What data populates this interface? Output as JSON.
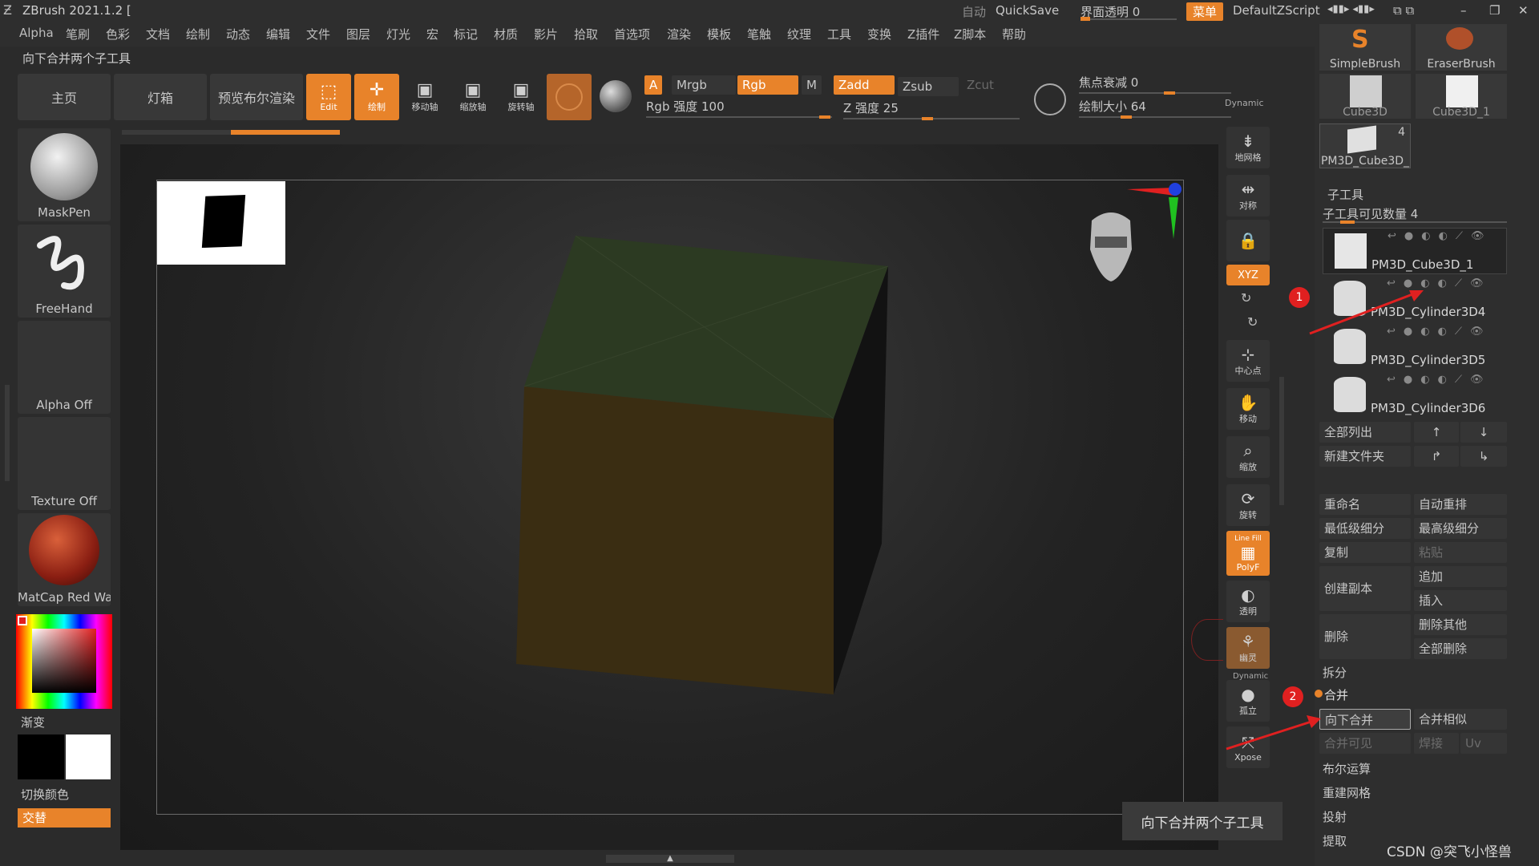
{
  "app": {
    "title": "ZBrush 2021.1.2 [",
    "auto_label": "自动",
    "quickscript": "QuickSave",
    "ui_transparency": "界面透明 0",
    "menu_pill": "菜单",
    "script_name": "DefaultZScript"
  },
  "menu": [
    "Alpha",
    "笔刷",
    "色彩",
    "文档",
    "绘制",
    "动态",
    "编辑",
    "文件",
    "图层",
    "灯光",
    "宏",
    "标记",
    "材质",
    "影片",
    "拾取",
    "首选项",
    "渲染",
    "模板",
    "笔触",
    "纹理",
    "工具",
    "变换",
    "Z插件",
    "Z脚本",
    "帮助"
  ],
  "status_text": "向下合并两个子工具",
  "toolbar": {
    "home": "主页",
    "lightbox": "灯箱",
    "bpr": "预览布尔渲染",
    "edit": "Edit",
    "draw": "绘制",
    "move": "移动轴",
    "scale": "缩放轴",
    "rotate": "旋转轴",
    "a": "A",
    "mrgb": "Mrgb",
    "rgb": "Rgb",
    "m": "M",
    "zadd": "Zadd",
    "zsub": "Zsub",
    "zcut": "Zcut",
    "rgb_intensity": "Rgb 强度 100",
    "z_intensity": "Z 强度 25",
    "focal_shift": "焦点衰减 0",
    "draw_size": "绘制大小 64",
    "dynamic": "Dynamic",
    "rgb_intensity_value": 100,
    "z_intensity_value": 25,
    "focal_shift_value": 0,
    "draw_size_value": 64
  },
  "left_panel": {
    "brush": "MaskPen",
    "stroke": "FreeHand",
    "alpha": "Alpha Off",
    "texture": "Texture Off",
    "material": "MatCap Red Wax",
    "gradient": "渐变",
    "switch_color": "切换颜色",
    "alternate": "交替"
  },
  "right_strip": {
    "floor": "地网格",
    "sym": "对称",
    "xyz": "XYZ",
    "center": "中心点",
    "move": "移动",
    "zoom": "缩放",
    "rotate": "旋转",
    "linefill_top": "Line Fill",
    "linefill": "PolyF",
    "transp": "透明",
    "ghost": "幽灵",
    "dynamic": "Dynamic",
    "solo": "孤立",
    "xpose": "Xpose"
  },
  "tool_palette": {
    "tools": [
      "SimpleBrush",
      "EraserBrush",
      "Cube3D",
      "Cube3D_1"
    ],
    "current_tool": "PM3D_Cube3D_",
    "current_count": "4"
  },
  "subtool": {
    "header": "子工具",
    "visible_count": "子工具可见数量 4",
    "items": [
      {
        "name": "PM3D_Cube3D_1"
      },
      {
        "name": "PM3D_Cylinder3D4"
      },
      {
        "name": "PM3D_Cylinder3D5"
      },
      {
        "name": "PM3D_Cylinder3D6"
      }
    ],
    "list_all": "全部列出",
    "new_folder": "新建文件夹",
    "rename": "重命名",
    "auto_reorder": "自动重排",
    "lowest_sub": "最低级细分",
    "highest_sub": "最高级细分",
    "copy": "复制",
    "paste": "粘贴",
    "append": "追加",
    "duplicate": "创建副本",
    "insert": "插入",
    "delete": "删除",
    "del_other": "删除其他",
    "del_all": "全部删除",
    "split": "拆分",
    "merge": "合并",
    "merge_down": "向下合并",
    "merge_similar": "合并相似",
    "merge_visible": "合并可见",
    "weld": "焊接",
    "uv": "Uv",
    "boolean": "布尔运算",
    "remesh": "重建网格",
    "project": "投射",
    "extract": "提取"
  },
  "annotations": {
    "badge1": "1",
    "badge2": "2"
  },
  "tooltip": "向下合并两个子工具",
  "watermark": "CSDN @突飞小怪兽",
  "colors": {
    "accent": "#e8832a",
    "panel": "#353535",
    "annotation": "#e02020"
  }
}
